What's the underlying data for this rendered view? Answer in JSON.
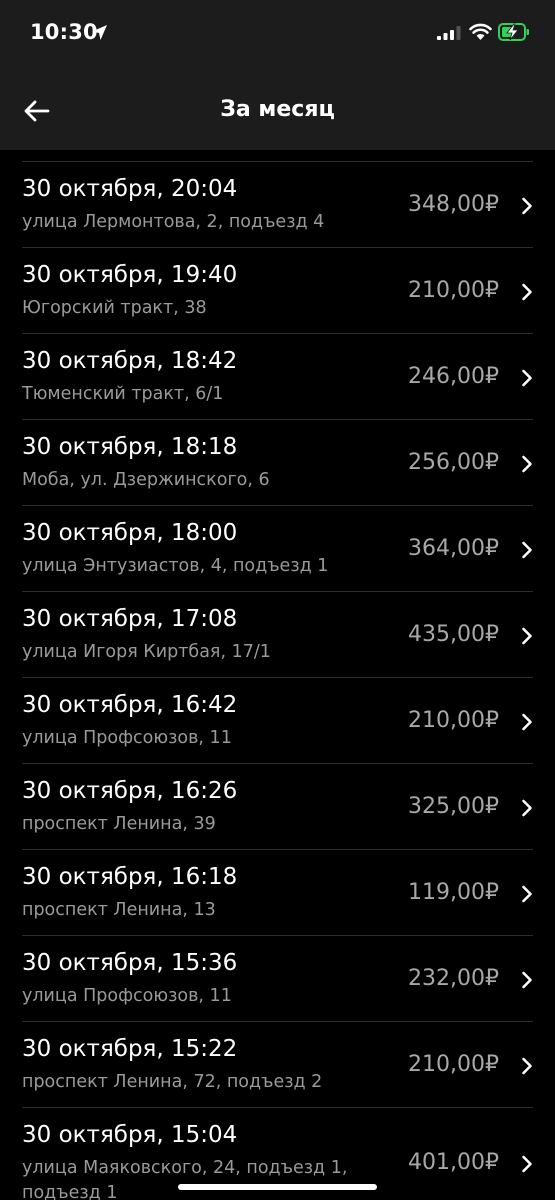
{
  "status_bar": {
    "time": "10:30",
    "icons": [
      "location-arrow-icon",
      "cell-signal-icon",
      "wifi-icon",
      "battery-charging-icon"
    ],
    "battery_color": "#30d158"
  },
  "header": {
    "title": "За месяц",
    "back_icon": "arrow-left-icon"
  },
  "rides": [
    {
      "when": "30 октября, 20:04",
      "address": "улица Лермонтова, 2, подъезд 4",
      "price": "348,00₽"
    },
    {
      "when": "30 октября, 19:40",
      "address": "Югорский тракт, 38",
      "price": "210,00₽"
    },
    {
      "when": "30 октября, 18:42",
      "address": "Тюменский тракт, 6/1",
      "price": "246,00₽"
    },
    {
      "when": "30 октября, 18:18",
      "address": "Моба, ул. Дзержинского, 6",
      "price": "256,00₽"
    },
    {
      "when": "30 октября, 18:00",
      "address": "улица Энтузиастов, 4, подъезд 1",
      "price": "364,00₽"
    },
    {
      "when": "30 октября, 17:08",
      "address": "улица Игоря Киртбая, 17/1",
      "price": "435,00₽"
    },
    {
      "when": "30 октября, 16:42",
      "address": "улица Профсоюзов, 11",
      "price": "210,00₽"
    },
    {
      "when": "30 октября, 16:26",
      "address": "проспект Ленина, 39",
      "price": "325,00₽"
    },
    {
      "when": "30 октября, 16:18",
      "address": "проспект Ленина, 13",
      "price": "119,00₽"
    },
    {
      "when": "30 октября, 15:36",
      "address": "улица Профсоюзов, 11",
      "price": "232,00₽"
    },
    {
      "when": "30 октября, 15:22",
      "address": "проспект Ленина, 72, подъезд 2",
      "price": "210,00₽"
    },
    {
      "when": "30 октября, 15:04",
      "address": "улица Маяковского, 24, подъезд 1, подъезд 1",
      "price": "401,00₽"
    }
  ]
}
